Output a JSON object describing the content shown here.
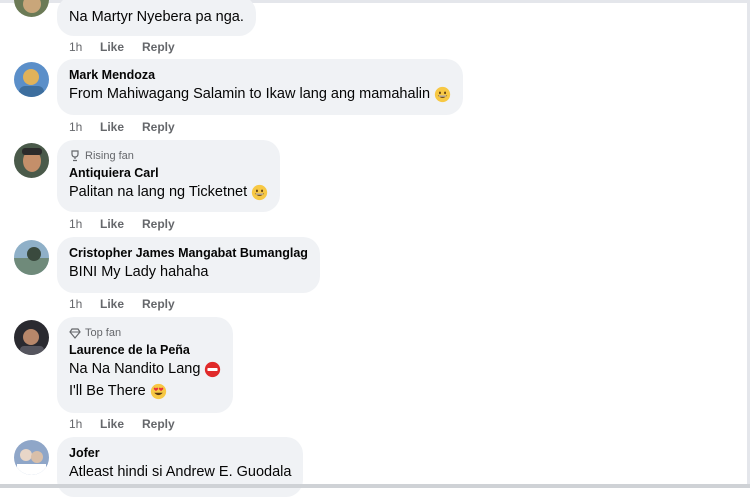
{
  "comments": [
    {
      "name": "",
      "badge": "",
      "lines": [
        "Na Martyr Nyebera pa nga."
      ],
      "time": "1h",
      "like": "Like",
      "reply": "Reply",
      "avatar_colors": [
        "#6b7a56",
        "#c9a67a"
      ]
    },
    {
      "name": "Mark Mendoza",
      "badge": "",
      "lines": [
        "From Mahiwagang Salamin to Ikaw lang ang mamahalin"
      ],
      "time": "1h",
      "like": "Like",
      "reply": "Reply",
      "emoji": "grinning-emoji",
      "avatar_colors": [
        "#5b8fc9",
        "#e0b25a"
      ]
    },
    {
      "name": "Antiquiera Carl",
      "badge": "Rising fan",
      "badge_icon": "trophy-icon",
      "lines": [
        "Palitan na lang ng Ticketnet"
      ],
      "time": "1h",
      "like": "Like",
      "reply": "Reply",
      "emoji": "grinning-emoji",
      "avatar_colors": [
        "#4a5a4a",
        "#c48f6a"
      ]
    },
    {
      "name": "Cristopher James Mangabat Bumanglag",
      "badge": "",
      "lines": [
        "BINI My Lady hahaha"
      ],
      "time": "1h",
      "like": "Like",
      "reply": "Reply",
      "avatar_colors": [
        "#6f8a7a",
        "#8fb0c8"
      ]
    },
    {
      "name": "Laurence de la Peña",
      "badge": "Top fan",
      "badge_icon": "diamond-icon",
      "lines": [
        "Na Na Nandito Lang",
        "I'll Be There"
      ],
      "time": "1h",
      "like": "Like",
      "reply": "Reply",
      "emojis": [
        "no-entry-emoji",
        "heart-eyes-emoji"
      ],
      "avatar_colors": [
        "#2a2a30",
        "#b7876a"
      ]
    },
    {
      "name": "Jofer",
      "badge": "",
      "lines": [
        "Atleast hindi si Andrew E. Guodala"
      ],
      "avatar_colors": [
        "#8fa6c8",
        "#e8d6c8"
      ]
    }
  ],
  "colors": {
    "bubble": "#f0f2f5",
    "meta_text": "#65676b",
    "text": "#050505"
  }
}
